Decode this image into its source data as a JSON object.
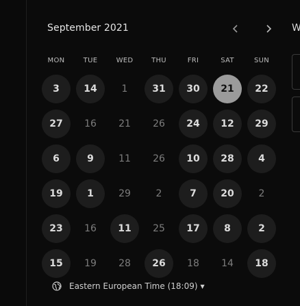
{
  "calendar": {
    "month_label": "September 2021",
    "weekdays": [
      "MON",
      "TUE",
      "WED",
      "THU",
      "FRI",
      "SAT",
      "SUN"
    ],
    "weeks": [
      [
        {
          "d": "3",
          "s": "available"
        },
        {
          "d": "14",
          "s": "available"
        },
        {
          "d": "1",
          "s": "disabled"
        },
        {
          "d": "31",
          "s": "available"
        },
        {
          "d": "30",
          "s": "available"
        },
        {
          "d": "21",
          "s": "selected"
        },
        {
          "d": "22",
          "s": "available"
        }
      ],
      [
        {
          "d": "27",
          "s": "available"
        },
        {
          "d": "16",
          "s": "disabled"
        },
        {
          "d": "21",
          "s": "disabled"
        },
        {
          "d": "26",
          "s": "disabled"
        },
        {
          "d": "24",
          "s": "available"
        },
        {
          "d": "12",
          "s": "available"
        },
        {
          "d": "29",
          "s": "available"
        }
      ],
      [
        {
          "d": "6",
          "s": "available"
        },
        {
          "d": "9",
          "s": "available"
        },
        {
          "d": "11",
          "s": "disabled"
        },
        {
          "d": "26",
          "s": "disabled"
        },
        {
          "d": "10",
          "s": "available"
        },
        {
          "d": "28",
          "s": "available"
        },
        {
          "d": "4",
          "s": "available"
        }
      ],
      [
        {
          "d": "19",
          "s": "available"
        },
        {
          "d": "1",
          "s": "available"
        },
        {
          "d": "29",
          "s": "disabled"
        },
        {
          "d": "2",
          "s": "disabled"
        },
        {
          "d": "7",
          "s": "available"
        },
        {
          "d": "20",
          "s": "available"
        },
        {
          "d": "2",
          "s": "disabled"
        }
      ],
      [
        {
          "d": "23",
          "s": "available"
        },
        {
          "d": "16",
          "s": "disabled"
        },
        {
          "d": "11",
          "s": "available"
        },
        {
          "d": "25",
          "s": "disabled"
        },
        {
          "d": "17",
          "s": "available"
        },
        {
          "d": "8",
          "s": "available"
        },
        {
          "d": "2",
          "s": "available"
        }
      ],
      [
        {
          "d": "15",
          "s": "available"
        },
        {
          "d": "19",
          "s": "disabled"
        },
        {
          "d": "28",
          "s": "disabled"
        },
        {
          "d": "26",
          "s": "available"
        },
        {
          "d": "18",
          "s": "disabled"
        },
        {
          "d": "14",
          "s": "disabled"
        },
        {
          "d": "18",
          "s": "available"
        }
      ]
    ]
  },
  "right_panel": {
    "label_fragment": "W"
  },
  "timezone": {
    "label": "Eastern European Time (18:09)"
  },
  "icons": {
    "prev": "chevron-left-icon",
    "next": "chevron-right-icon",
    "globe": "globe-icon",
    "caret": "caret-down-icon"
  },
  "colors": {
    "background": "#0b0b0b",
    "available_circle": "#1d1d1d",
    "selected_circle": "#9b9b9b",
    "disabled_text": "#7d7d7d"
  }
}
